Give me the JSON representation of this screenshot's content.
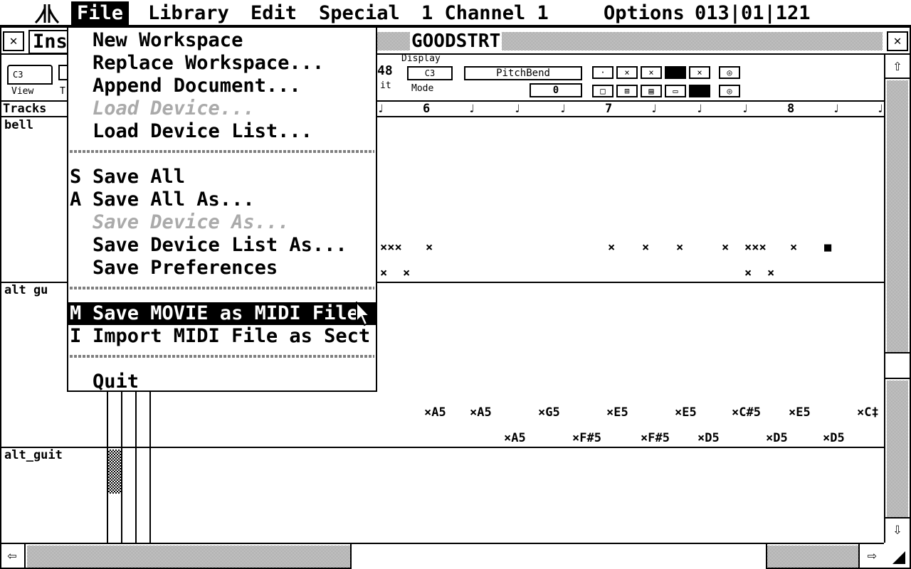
{
  "menubar": {
    "items": [
      {
        "label": "File",
        "selected": true
      },
      {
        "label": "Library",
        "selected": false
      },
      {
        "label": "Edit",
        "selected": false
      },
      {
        "label": "Special",
        "selected": false
      },
      {
        "label": "1 Channel 1",
        "selected": false
      },
      {
        "label": "Options",
        "selected": false
      }
    ],
    "position": "013|01|121"
  },
  "window": {
    "title": "GOODSTRT",
    "close_glyph": "✕",
    "full_glyph": "✕",
    "left_tab": "Ins"
  },
  "toolbar": {
    "view_label": "View",
    "t_label": "T",
    "left_chip": "C3",
    "number_fragment": "48",
    "it_fragment": "it",
    "display_label": "Display",
    "display_chip": "C3",
    "mode_label": "Mode",
    "pitchbend_label": "PitchBend",
    "value": "0"
  },
  "tracks_header": {
    "label": "Tracks",
    "bars": [
      "6",
      "7",
      "8"
    ]
  },
  "tracks": [
    {
      "name": "bell"
    },
    {
      "name": "alt gu"
    },
    {
      "name": "alt_guit"
    }
  ],
  "notes": {
    "bell_row1": [
      "×××",
      "×",
      "×",
      "×",
      "×",
      "×",
      "×××",
      "×",
      "■"
    ],
    "bell_row2": [
      "×",
      "×",
      "×",
      "×"
    ],
    "alt_row1": [
      "×A5",
      "×A5",
      "×G5",
      "×E5",
      "×E5",
      "×C#5",
      "×E5",
      "×C‡"
    ],
    "alt_row2": [
      "×A5",
      "×F#5",
      "×F#5",
      "×D5",
      "×D5",
      "×D5"
    ]
  },
  "file_menu": {
    "items": [
      {
        "shortcut": "",
        "label": "New Workspace",
        "disabled": false
      },
      {
        "shortcut": "",
        "label": "Replace Workspace...",
        "disabled": false
      },
      {
        "shortcut": "",
        "label": "Append Document...",
        "disabled": false
      },
      {
        "shortcut": "",
        "label": "Load Device...",
        "disabled": true
      },
      {
        "shortcut": "",
        "label": "Load Device List...",
        "disabled": false
      },
      {
        "shortcut": "S",
        "label": "Save All",
        "disabled": false
      },
      {
        "shortcut": "A",
        "label": "Save All As...",
        "disabled": false
      },
      {
        "shortcut": "",
        "label": "Save Device As...",
        "disabled": true
      },
      {
        "shortcut": "",
        "label": "Save Device List As...",
        "disabled": false
      },
      {
        "shortcut": "",
        "label": "Save Preferences",
        "disabled": false
      },
      {
        "shortcut": "M",
        "label": "Save MOVIE as MIDI File",
        "disabled": false,
        "highlighted": true
      },
      {
        "shortcut": "I",
        "label": "Import MIDI File as Sect",
        "disabled": false
      },
      {
        "shortcut": "",
        "label": "Quit",
        "disabled": false
      }
    ]
  },
  "icons": {
    "logo": "atari-logo",
    "scroll_up": "⇧",
    "scroll_down": "⇩",
    "scroll_left": "⇦",
    "scroll_right": "⇨"
  }
}
